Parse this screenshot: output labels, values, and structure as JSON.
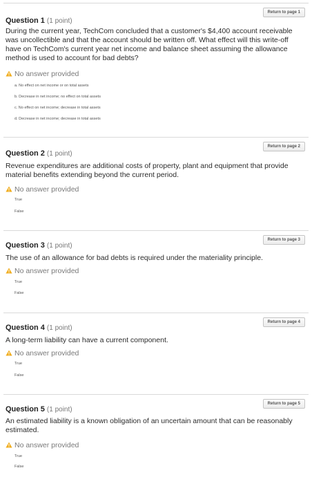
{
  "questions": [
    {
      "title": "Question 1",
      "points": "(1 point)",
      "return_label": "Return to page 1",
      "text": "During the current year, TechCom concluded that a customer's $4,400 account receivable was uncollectible and that the account should be written off. What effect will this write-off have on TechCom's current year net income and balance sheet assuming the allowance method is used to account for bad debts?",
      "status": "No answer provided",
      "options": [
        "a. No effect on net income or on total assets",
        "b. Decrease in net income; no effect on total assets",
        "c. No effect on net income; decrease in total assets",
        "d. Decrease in net income; decrease in total assets"
      ]
    },
    {
      "title": "Question 2",
      "points": "(1 point)",
      "return_label": "Return to page 2",
      "text": "Revenue expenditures are additional costs of property, plant and equipment that provide material benefits extending beyond the current period.",
      "status": "No answer provided",
      "options": [
        "True",
        "False"
      ]
    },
    {
      "title": "Question 3",
      "points": "(1 point)",
      "return_label": "Return to page 3",
      "text": "The use of an allowance for bad debts is required under the materiality principle.",
      "status": "No answer provided",
      "options": [
        "True",
        "False"
      ]
    },
    {
      "title": "Question 4",
      "points": "(1 point)",
      "return_label": "Return to page 4",
      "text": "A long-term liability can have a current component.",
      "status": "No answer provided",
      "options": [
        "True",
        "False"
      ]
    },
    {
      "title": "Question 5",
      "points": "(1 point)",
      "return_label": "Return to page 5",
      "text": "An estimated liability is a known obligation of an uncertain amount that can be reasonably estimated.",
      "status": "No answer provided",
      "options": [
        "True",
        "False"
      ]
    }
  ],
  "icons": {
    "status": "warning-triangle-icon"
  },
  "colors": {
    "warning": "#f0ad1f",
    "divider": "#d9d9d9"
  }
}
